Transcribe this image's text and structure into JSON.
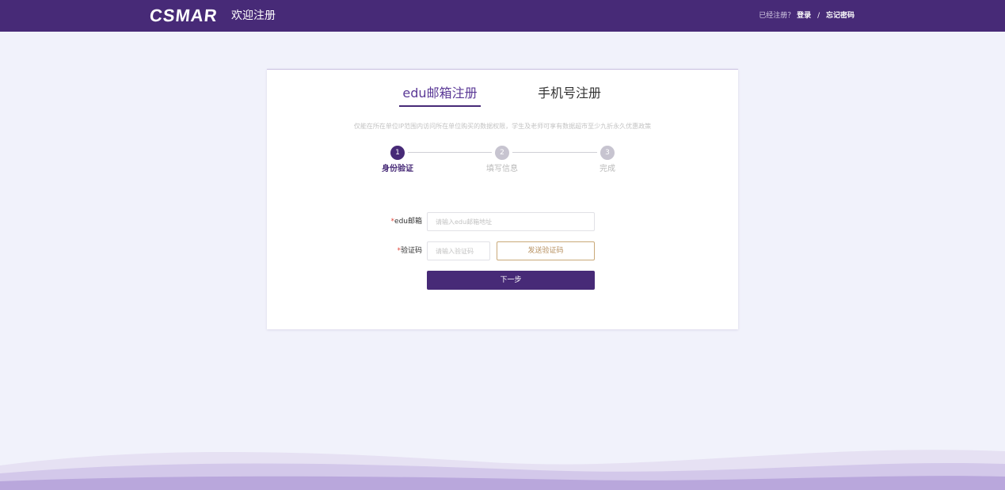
{
  "header": {
    "logo": "CSMAR",
    "welcome": "欢迎注册",
    "registered_prompt": "已经注册？",
    "login_link": "登录",
    "separator": "/",
    "forgot_link": "忘记密码"
  },
  "tabs": [
    {
      "label": "edu邮箱注册",
      "active": true
    },
    {
      "label": "手机号注册",
      "active": false
    }
  ],
  "notice": "仅能在所在单位IP范围内访问所在单位购买的数据权限，学生及老师可享有数据超市至少九折永久优惠政策",
  "steps": [
    {
      "number": "1",
      "label": "身份验证",
      "active": true
    },
    {
      "number": "2",
      "label": "填写信息",
      "active": false
    },
    {
      "number": "3",
      "label": "完成",
      "active": false
    }
  ],
  "form": {
    "required_mark": "*",
    "email_label": "edu邮箱",
    "email_placeholder": "请输入edu邮箱地址",
    "code_label": "验证码",
    "code_placeholder": "请输入验证码",
    "send_code": "发送验证码",
    "next": "下一步"
  },
  "colors": {
    "brand": "#472a77",
    "background": "#f1f2fb",
    "required": "#e0463b",
    "send_code_border": "#c9a979"
  }
}
